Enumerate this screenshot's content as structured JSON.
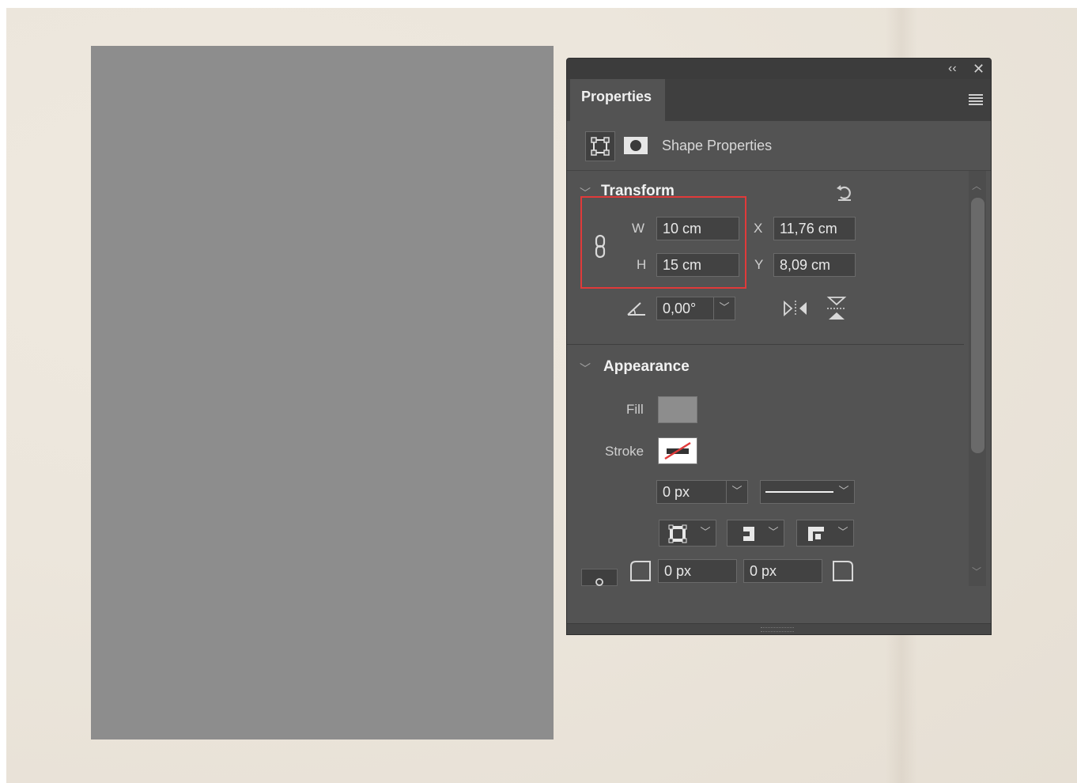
{
  "panel": {
    "title": "Properties",
    "subheader_label": "Shape Properties"
  },
  "transform": {
    "title": "Transform",
    "w_label": "W",
    "h_label": "H",
    "x_label": "X",
    "y_label": "Y",
    "width": "10 cm",
    "height": "15 cm",
    "x": "11,76 cm",
    "y": "8,09 cm",
    "angle": "0,00°"
  },
  "appearance": {
    "title": "Appearance",
    "fill_label": "Fill",
    "stroke_label": "Stroke",
    "fill_color": "#8d8d8d",
    "stroke_width": "0 px",
    "corner_radius_left": "0 px",
    "corner_radius_right": "0 px"
  },
  "colors": {
    "shape_fill": "#8d8d8d",
    "highlight": "#e03a3a"
  }
}
